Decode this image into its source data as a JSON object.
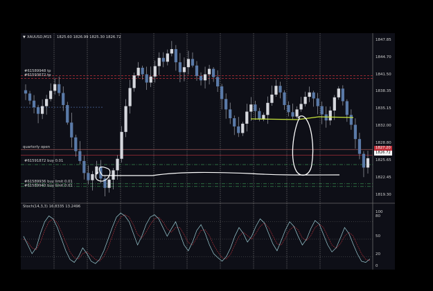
{
  "chart_header": {
    "symbol_label": "XAUUSD,M15",
    "ohlc_label": "1825.60 1826.99 1825.30 1826.72",
    "menu_icon": "triangle-down-icon"
  },
  "price_axis": {
    "labels": [
      "1847.85",
      "1844.70",
      "1841.50",
      "1838.35",
      "1835.15",
      "1832.00",
      "1828.80",
      "1825.65",
      "1822.45",
      "1819.30"
    ],
    "bid_tag": "1827.20",
    "current_tag": "1826.72"
  },
  "order_lines": {
    "tp1": "#61589948 tp",
    "tp2": "#61593672 tp",
    "quarterly": "quarterly open",
    "buy1": "#61591872 buy 0.01",
    "buy_limit1": "#61589936 buy limit 0.01",
    "buy_limit2": "#61589940 buy limit 0.01"
  },
  "stoch": {
    "header": "Stoch(14,3,3) 16.8335 13.2496",
    "axis_labels": [
      "100",
      "80",
      "50",
      "20",
      "0"
    ]
  },
  "colors": {
    "background": "#0e0f17",
    "annotation_white": "#ffffff",
    "annotation_yellow": "#c9e63a",
    "tp_line": "#c0323c",
    "buy_line": "#3fa05a",
    "stoch_main": "#9fd0d8"
  },
  "chart_data": {
    "type": "candlestick",
    "symbol": "XAUUSD",
    "timeframe": "M15",
    "ylim": [
      1818.5,
      1849.0
    ],
    "yticks": [
      1847.85,
      1844.7,
      1841.5,
      1838.35,
      1835.15,
      1832.0,
      1828.8,
      1825.65,
      1822.45,
      1819.3
    ],
    "last_ohlc": {
      "open": 1825.6,
      "high": 1826.99,
      "low": 1825.3,
      "close": 1826.72
    },
    "closes": [
      1838.5,
      1837.2,
      1836.0,
      1834.8,
      1836.2,
      1837.5,
      1839.0,
      1840.2,
      1838.6,
      1836.4,
      1833.2,
      1830.5,
      1828.0,
      1826.2,
      1824.0,
      1822.7,
      1823.8,
      1825.2,
      1823.0,
      1821.3,
      1822.8,
      1824.5,
      1826.6,
      1831.5,
      1836.2,
      1839.5,
      1841.8,
      1843.2,
      1842.0,
      1840.5,
      1841.6,
      1843.5,
      1845.0,
      1844.3,
      1845.8,
      1846.6,
      1844.2,
      1842.4,
      1843.3,
      1844.8,
      1843.6,
      1841.7,
      1840.9,
      1842.0,
      1843.0,
      1841.5,
      1839.8,
      1837.5,
      1835.6,
      1834.0,
      1832.5,
      1831.3,
      1833.0,
      1835.2,
      1836.5,
      1835.3,
      1833.8,
      1834.6,
      1836.8,
      1838.3,
      1839.9,
      1838.7,
      1836.4,
      1835.1,
      1834.3,
      1835.6,
      1836.6,
      1837.9,
      1838.7,
      1837.6,
      1836.2,
      1834.7,
      1833.6,
      1835.4,
      1837.8,
      1839.4,
      1837.1,
      1834.6,
      1832.8,
      1830.2,
      1827.5,
      1825.0,
      1826.7
    ],
    "stoch_k": [
      55,
      40,
      25,
      35,
      60,
      80,
      90,
      85,
      70,
      50,
      30,
      15,
      10,
      20,
      35,
      25,
      12,
      8,
      15,
      30,
      50,
      70,
      88,
      95,
      90,
      80,
      60,
      40,
      55,
      75,
      88,
      92,
      85,
      70,
      55,
      68,
      80,
      60,
      40,
      30,
      45,
      65,
      75,
      60,
      40,
      25,
      18,
      12,
      20,
      35,
      55,
      70,
      60,
      45,
      55,
      72,
      85,
      78,
      60,
      42,
      30,
      48,
      66,
      80,
      72,
      55,
      40,
      50,
      68,
      82,
      76,
      58,
      40,
      28,
      35,
      52,
      70,
      60,
      42,
      25,
      12,
      10,
      16
    ],
    "stoch_d": [
      50,
      45,
      35,
      32,
      45,
      65,
      80,
      85,
      78,
      62,
      45,
      28,
      18,
      16,
      25,
      28,
      22,
      15,
      12,
      20,
      35,
      55,
      75,
      88,
      92,
      88,
      75,
      58,
      52,
      62,
      75,
      85,
      88,
      80,
      68,
      62,
      70,
      70,
      58,
      44,
      40,
      52,
      65,
      66,
      56,
      40,
      28,
      18,
      16,
      24,
      40,
      55,
      62,
      56,
      50,
      60,
      72,
      78,
      70,
      56,
      42,
      40,
      52,
      66,
      72,
      66,
      52,
      48,
      56,
      70,
      76,
      70,
      55,
      40,
      34,
      42,
      55,
      62,
      56,
      40,
      25,
      15,
      13
    ]
  }
}
